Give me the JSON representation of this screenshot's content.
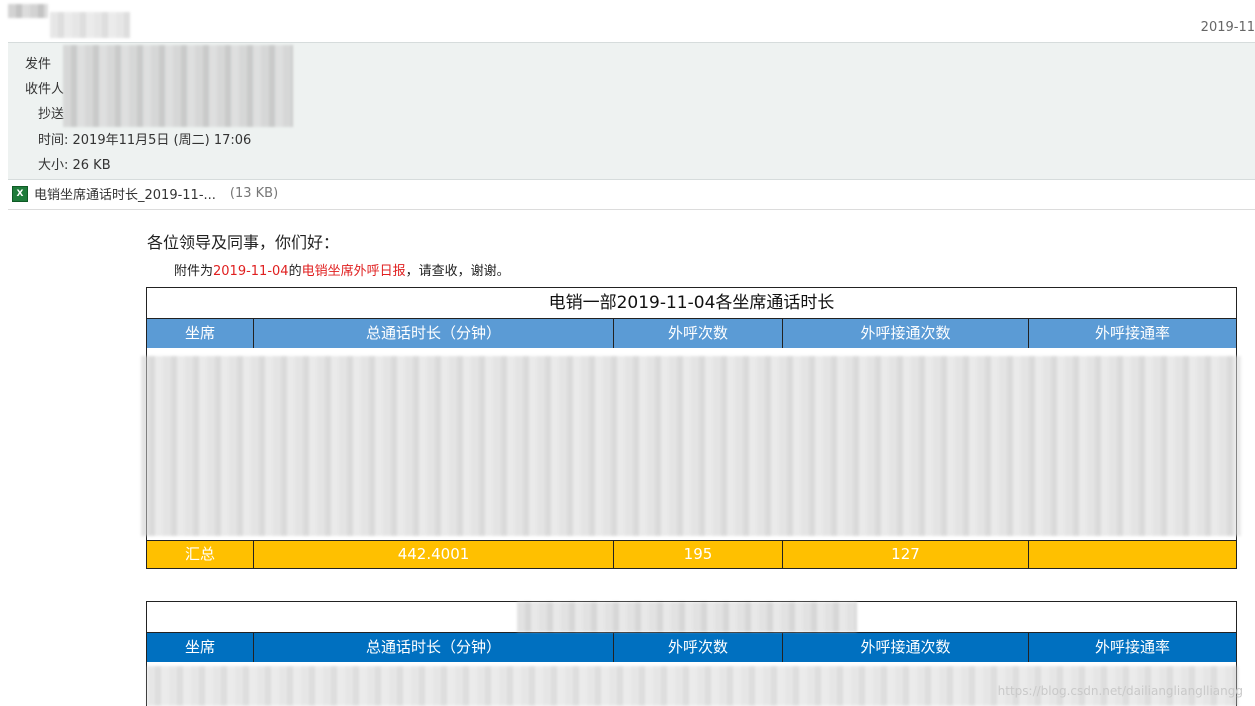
{
  "top": {
    "date": "2019-11"
  },
  "header": {
    "from_label": "发件",
    "to_label": "收件人",
    "cc_label": "抄送",
    "time": "时间: 2019年11月5日 (周二) 17:06",
    "size": "大小: 26 KB"
  },
  "attachment": {
    "name": "电销坐席通话时长_2019-11-...",
    "size": "(13 KB)"
  },
  "body": {
    "greeting": "各位领导及同事，你们好：",
    "line_prefix": "附件为",
    "date_red": "2019-11-04",
    "line_mid": "的",
    "report_red": "电销坐席外呼日报",
    "line_suffix": "，请查收，谢谢。"
  },
  "table1": {
    "title": "电销一部2019-11-04各坐席通话时长",
    "headers": [
      "坐席",
      "总通话时长（分钟）",
      "外呼次数",
      "外呼接通次数",
      "外呼接通率"
    ],
    "footer": [
      "汇总",
      "442.4001",
      "195",
      "127",
      ""
    ],
    "header_bg": "#5b9bd5",
    "footer_bg": "#ffc000"
  },
  "table2": {
    "headers": [
      "坐席",
      "总通话时长（分钟）",
      "外呼次数",
      "外呼接通次数",
      "外呼接通率"
    ],
    "header_bg": "#0070c0"
  },
  "watermark": "https://blog.csdn.net/dailianglianglliangg"
}
